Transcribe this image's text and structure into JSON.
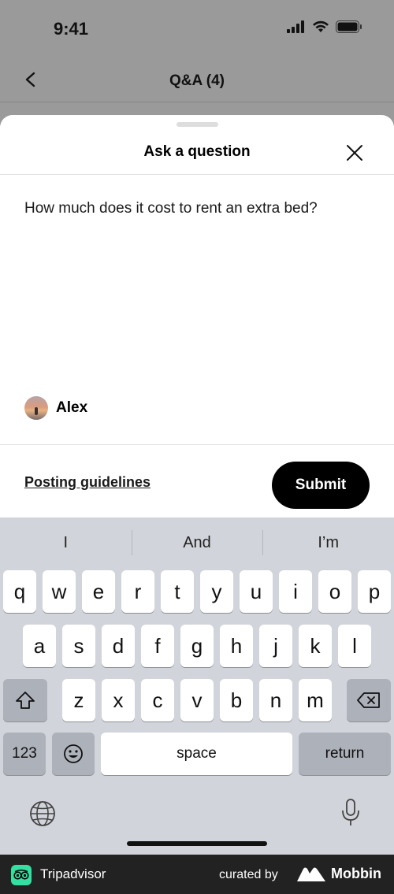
{
  "status_bar": {
    "time": "9:41"
  },
  "background_page": {
    "title": "Q&A (4)"
  },
  "sheet": {
    "title": "Ask a question",
    "question": "How much does it cost to rent an extra bed?",
    "author": "Alex",
    "guidelines_link": "Posting guidelines",
    "submit_label": "Submit"
  },
  "keyboard": {
    "suggestions": [
      "I",
      "And",
      "I’m"
    ],
    "row1": [
      "q",
      "w",
      "e",
      "r",
      "t",
      "y",
      "u",
      "i",
      "o",
      "p"
    ],
    "row2": [
      "a",
      "s",
      "d",
      "f",
      "g",
      "h",
      "j",
      "k",
      "l"
    ],
    "row3": [
      "z",
      "x",
      "c",
      "v",
      "b",
      "n",
      "m"
    ],
    "numbers_label": "123",
    "space_label": "space",
    "return_label": "return"
  },
  "branding": {
    "app_name": "Tripadvisor",
    "curated_by": "curated by",
    "mobbin": "Mobbin"
  },
  "colors": {
    "tripadvisor_green": "#34e0a1",
    "submit_bg": "#000000",
    "keyboard_bg": "#d1d4da"
  }
}
